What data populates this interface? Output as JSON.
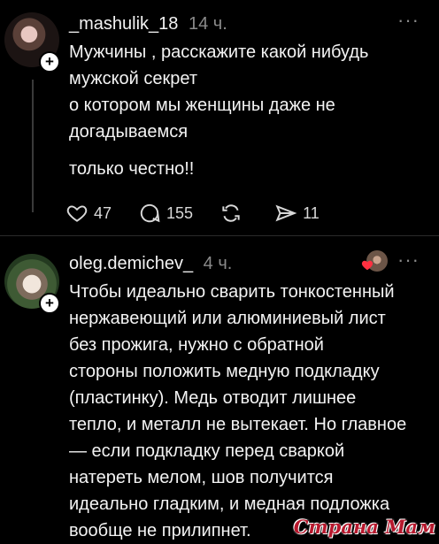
{
  "post1": {
    "username": "_mashulik_18",
    "time": "14 ч.",
    "more_icon": "···",
    "paragraphs": [
      [
        "Мужчины , расскажите какой нибудь",
        "мужской секрет",
        "о котором мы женщины  даже не",
        "догадываемся"
      ],
      [
        "только честно!!"
      ]
    ],
    "likes": "47",
    "comments": "155",
    "shares": "11"
  },
  "post2": {
    "username": "oleg.demichev_",
    "time": "4 ч.",
    "more_icon": "···",
    "lines": [
      "Чтобы идеально сварить тонкостенный",
      "нержавеющий или алюминиевый лист",
      "без прожига, нужно с обратной",
      "стороны положить медную подкладку",
      "(пластинку). Медь отводит лишнее",
      "тепло, и металл не вытекает. Но главное",
      "— если подкладку перед сваркой",
      "натереть мелом, шов получится",
      "идеально гладким, и медная подложка",
      "вообще не прилипнет."
    ]
  },
  "watermark": "Страна Мам",
  "colors": {
    "background": "#000000",
    "text": "#f3f3f3",
    "muted": "#8a8a8a",
    "heart": "#ff3040"
  }
}
